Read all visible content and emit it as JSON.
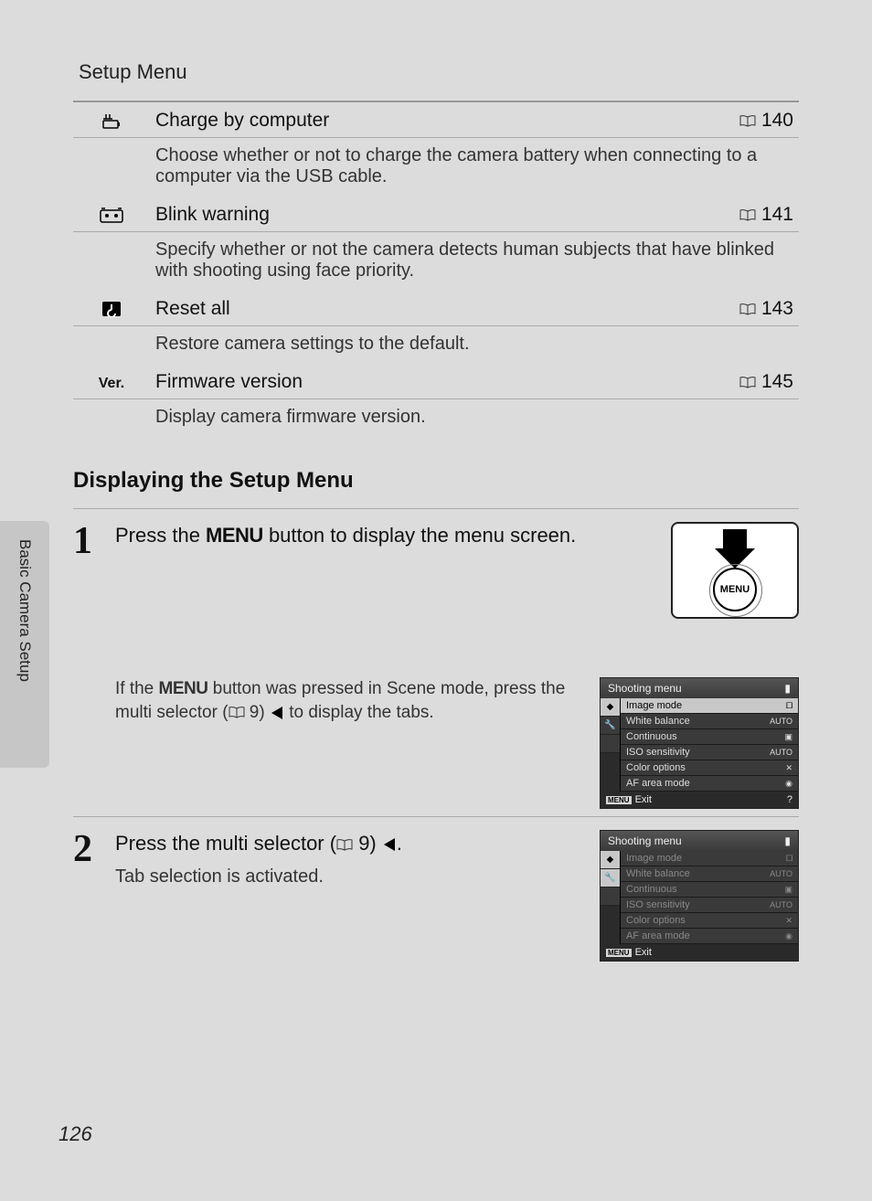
{
  "header": {
    "title": "Setup Menu"
  },
  "side_tab": "Basic Camera Setup",
  "setup_rows": [
    {
      "icon": "charge-icon",
      "label": "Charge by computer",
      "page": "140",
      "desc": "Choose whether or not to charge the camera battery when connecting to a computer via the USB cable."
    },
    {
      "icon": "blink-icon",
      "label": "Blink warning",
      "page": "141",
      "desc": "Specify whether or not the camera detects human subjects that have blinked with shooting using face priority."
    },
    {
      "icon": "reset-icon",
      "label": "Reset all",
      "page": "143",
      "desc": "Restore camera settings to the default."
    },
    {
      "icon": "ver-icon",
      "label": "Firmware version",
      "page": "145",
      "desc": "Display camera firmware version."
    }
  ],
  "section_heading": "Displaying the Setup Menu",
  "step1": {
    "num": "1",
    "text_a": "Press the ",
    "text_menu": "MENU",
    "text_b": " button to display the menu screen.",
    "note_a": "If the ",
    "note_b": " button was pressed in Scene mode, press the multi selector (",
    "note_pg": " 9) ",
    "note_c": " to display the tabs.",
    "menu_btn_label": "MENU"
  },
  "step2": {
    "num": "2",
    "text_a": "Press the multi selector (",
    "text_pg": " 9) ",
    "text_b": ".",
    "sub": "Tab selection is activated."
  },
  "lcd": {
    "title": "Shooting menu",
    "items": [
      {
        "label": "Image mode",
        "val": "🞐"
      },
      {
        "label": "White balance",
        "val": "AUTO"
      },
      {
        "label": "Continuous",
        "val": "▣"
      },
      {
        "label": "ISO sensitivity",
        "val": "AUTO"
      },
      {
        "label": "Color options",
        "val": "✕"
      },
      {
        "label": "AF area mode",
        "val": "◉"
      }
    ],
    "exit_menu": "MENU",
    "exit": "Exit",
    "help": "?"
  },
  "page_number": "126"
}
